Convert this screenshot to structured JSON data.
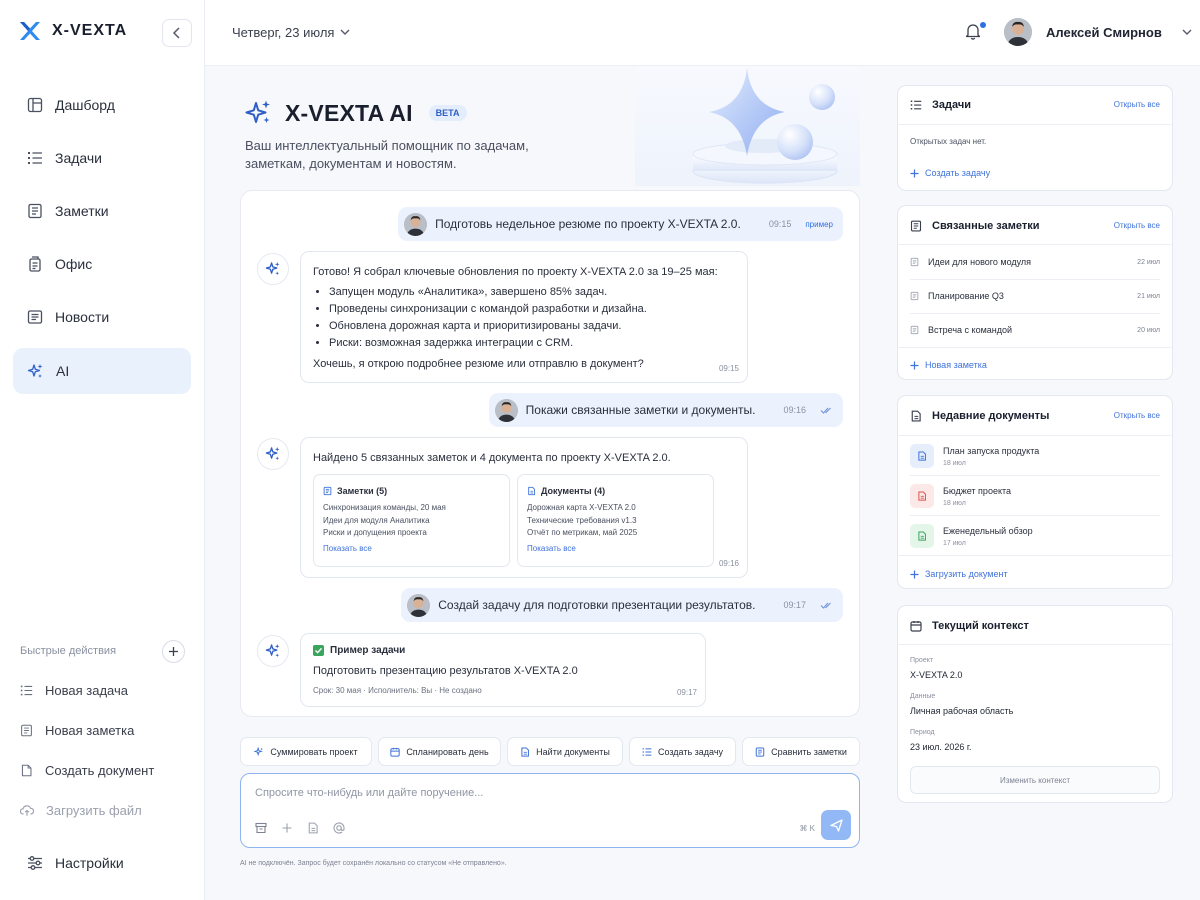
{
  "app": {
    "name": "X-VEXTA"
  },
  "sidebar": {
    "items": [
      {
        "label": "Дашборд",
        "icon": "layout-icon"
      },
      {
        "label": "Задачи",
        "icon": "list-icon"
      },
      {
        "label": "Заметки",
        "icon": "note-icon"
      },
      {
        "label": "Офис",
        "icon": "office-icon"
      },
      {
        "label": "Новости",
        "icon": "news-icon"
      },
      {
        "label": "AI",
        "icon": "sparkle-icon",
        "active": true
      }
    ],
    "quick_title": "Быстрые действия",
    "quick": [
      {
        "label": "Новая задача"
      },
      {
        "label": "Новая заметка"
      },
      {
        "label": "Создать документ"
      },
      {
        "label": "Загрузить файл"
      }
    ],
    "settings": "Настройки"
  },
  "topbar": {
    "date": "Четверг, 23 июля",
    "user": "Алексей Смирнов"
  },
  "hero": {
    "title": "X-VEXTA AI",
    "badge": "BETA",
    "subtitle": "Ваш интеллектуальный помощник по задачам, заметкам, документам и новостям."
  },
  "chat": {
    "m1": {
      "text": "Подготовь недельное резюме по проекту X-VEXTA 2.0.",
      "time": "09:15",
      "tag": "пример"
    },
    "a1": {
      "intro": "Готово! Я собрал ключевые обновления по проекту X-VEXTA 2.0 за 19–25 мая:",
      "bullets": [
        "Запущен модуль «Аналитика», завершено 85% задач.",
        "Проведены синхронизации с командой разработки и дизайна.",
        "Обновлена дорожная карта и приоритизированы задачи.",
        "Риски: возможная задержка интеграции с CRM."
      ],
      "outro": "Хочешь, я открою подробнее резюме или отправлю в документ?",
      "time": "09:15"
    },
    "m2": {
      "text": "Покажи связанные заметки и документы.",
      "time": "09:16"
    },
    "a2": {
      "intro": "Найдено 5 связанных заметок и 4 документа по проекту X-VEXTA 2.0.",
      "notes": {
        "title": "Заметки (5)",
        "lines": [
          "Синхронизация команды, 20 мая",
          "Идеи для модуля Аналитика",
          "Риски и допущения проекта"
        ],
        "link": "Показать все"
      },
      "docs": {
        "title": "Документы (4)",
        "lines": [
          "Дорожная карта X-VEXTA 2.0",
          "Технические требования v1.3",
          "Отчёт по метрикам, май 2025"
        ],
        "link": "Показать все"
      },
      "time": "09:16"
    },
    "m3": {
      "text": "Создай задачу для подготовки презентации результатов.",
      "time": "09:17"
    },
    "a3": {
      "title": "Пример задачи",
      "text": "Подготовить презентацию результатов X-VEXTA 2.0",
      "meta": "Срок: 30 мая · Исполнитель: Вы · Не создано",
      "time": "09:17"
    }
  },
  "chips": [
    "Суммировать проект",
    "Спланировать день",
    "Найти документы",
    "Создать задачу",
    "Сравнить заметки"
  ],
  "input": {
    "placeholder": "Спросите что-нибудь или дайте поручение...",
    "shortcut": "⌘ K"
  },
  "footnote": "AI не подключён. Запрос будет сохранён локально со статусом «Не отправлено».",
  "right": {
    "tasks": {
      "title": "Задачи",
      "open": "Открыть все",
      "empty": "Открытых задач нет.",
      "action": "Создать задачу"
    },
    "notes": {
      "title": "Связанные заметки",
      "open": "Открыть все",
      "rows": [
        {
          "name": "Идеи для нового модуля",
          "date": "22 июл"
        },
        {
          "name": "Планирование Q3",
          "date": "21 июл"
        },
        {
          "name": "Встреча с командой",
          "date": "20 июл"
        }
      ],
      "action": "Новая заметка"
    },
    "docs": {
      "title": "Недавние документы",
      "open": "Открыть все",
      "rows": [
        {
          "name": "План запуска продукта",
          "date": "18 июл",
          "color": "#3f72d9",
          "bg": "#e6eefc"
        },
        {
          "name": "Бюджет проекта",
          "date": "18 июл",
          "color": "#d9534f",
          "bg": "#fce8e7"
        },
        {
          "name": "Еженедельный обзор",
          "date": "17 июл",
          "color": "#3aa55d",
          "bg": "#e4f5e9"
        }
      ],
      "action": "Загрузить документ"
    },
    "context": {
      "title": "Текущий контекст",
      "project_label": "Проект",
      "project": "X-VEXTA 2.0",
      "data_label": "Данные",
      "data": "Личная рабочая область",
      "period_label": "Период",
      "period": "23 июл. 2026 г.",
      "button": "Изменить контекст"
    }
  },
  "colors": {
    "accent": "#2f6fe4",
    "active_bg": "#e9f1fd"
  }
}
